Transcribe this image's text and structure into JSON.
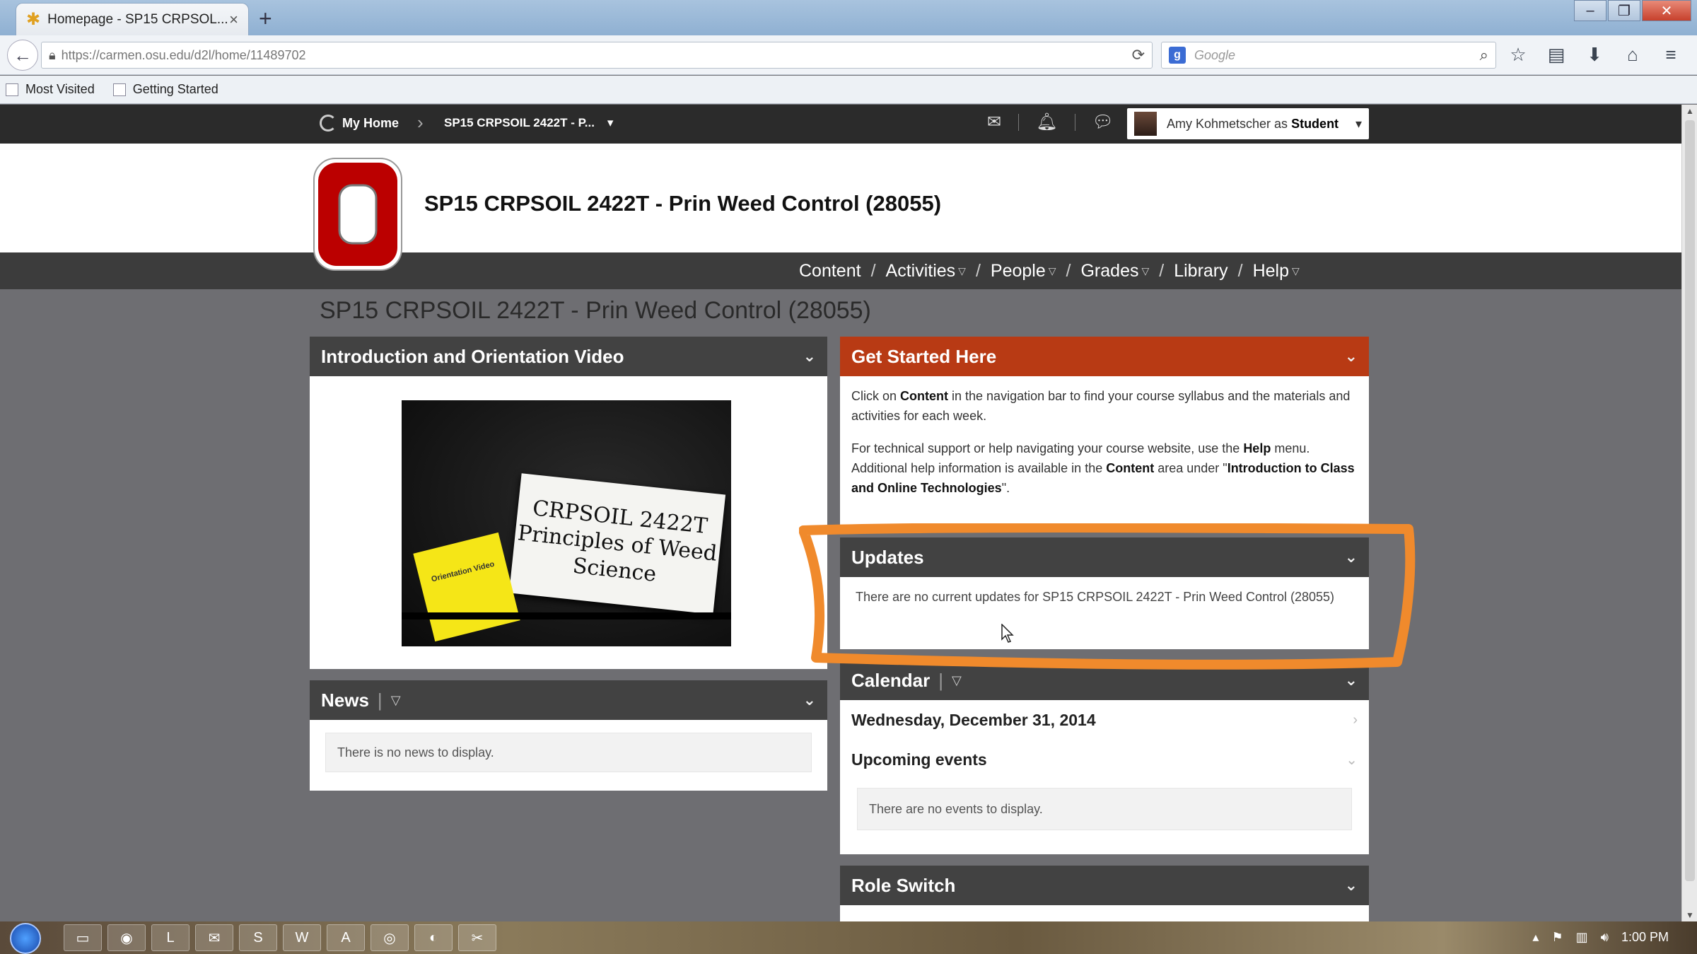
{
  "browser": {
    "tab_title": "Homepage - SP15 CRPSOL...",
    "new_tab": "+",
    "url": "https://carmen.osu.edu/d2l/home/11489702",
    "search_placeholder": "Google",
    "bookmarks": [
      "Most Visited",
      "Getting Started"
    ]
  },
  "d2l_bar": {
    "my_home": "My Home",
    "course_selector": "SP15 CRPSOIL 2422T - P...",
    "course_selector_caret": "▾",
    "user_label": "Amy Kohmetscher as ",
    "user_role": "Student"
  },
  "course": {
    "title": "SP15 CRPSOIL 2422T - Prin Weed Control (28055)",
    "page_title": "SP15 CRPSOIL 2422T - Prin Weed Control (28055)"
  },
  "course_nav": {
    "items": [
      {
        "label": "Content",
        "has_menu": false
      },
      {
        "label": "Activities",
        "has_menu": true
      },
      {
        "label": "People",
        "has_menu": true
      },
      {
        "label": "Grades",
        "has_menu": true
      },
      {
        "label": "Library",
        "has_menu": false
      },
      {
        "label": "Help",
        "has_menu": true
      }
    ],
    "separator": "/"
  },
  "widgets": {
    "intro_video": {
      "title": "Introduction and Orientation Video",
      "card_text": "CRPSOIL 2422T Principles of Weed Science",
      "sticky_text": "Orientation Video"
    },
    "news": {
      "title": "News",
      "empty": "There is no news to display."
    },
    "get_started": {
      "title": "Get Started Here",
      "p1_a": "Click on ",
      "p1_b": "Content",
      "p1_c": " in the navigation bar to find your course syllabus and the materials and activities for each week.",
      "p2_a": "For technical support or help navigating your course website, use the ",
      "p2_b": "Help",
      "p2_c": " menu. Additional help information is available in the ",
      "p2_d": "Content",
      "p2_e": " area under \"",
      "p2_f": "Introduction to Class and Online Technologies",
      "p2_g": "\"."
    },
    "updates": {
      "title": "Updates",
      "body": "There are no current updates for SP15 CRPSOIL 2422T - Prin Weed Control (28055)"
    },
    "calendar": {
      "title": "Calendar",
      "date": "Wednesday, December 31, 2014",
      "upcoming": "Upcoming events",
      "empty": "There are no events to display."
    },
    "role_switch": {
      "title": "Role Switch"
    }
  },
  "taskbar": {
    "time": "1:00 PM"
  },
  "colors": {
    "osu_red": "#bb0000",
    "widget_header": "#424242",
    "get_started_header": "#b83a14",
    "annotation_orange": "#f08a2c"
  }
}
